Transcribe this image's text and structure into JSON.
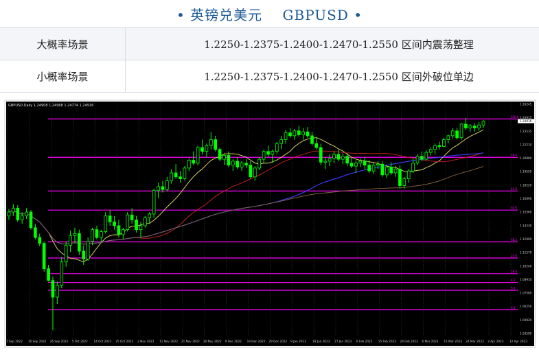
{
  "header": {
    "title": "英镑兑美元",
    "symbol": "GBPUSD",
    "dot": "•"
  },
  "scenarios": [
    {
      "label": "大概率场景",
      "value": "1.2250-1.2375-1.2400-1.2470-1.2550 区间内震荡整理"
    },
    {
      "label": "小概率场景",
      "value": "1.2250-1.2375-1.2400-1.2470-1.2550 区间外破位单边"
    }
  ],
  "chart_data": {
    "type": "candlestick",
    "symbol_label": "GBPUSD,Daily  1.24908 1.24968 1.24774 1.24916",
    "timeframe": "Daily",
    "price_tick_labels": [
      "1.26245",
      "1.24915",
      "1.23535",
      "1.22210",
      "1.20880",
      "1.19550",
      "1.18220",
      "1.16890",
      "1.15560",
      "1.14230",
      "1.12900",
      "1.11570",
      "1.10240",
      "1.08910",
      "1.07580",
      "1.06250",
      "1.04920",
      "1.03590"
    ],
    "current_price": "1.24916",
    "date_labels": [
      "7 Sep 2022",
      "16 Sep 2022",
      "26 Sep 2022",
      "5 Oct 2022",
      "14 Oct 2022",
      "25 Oct 2022",
      "2 Nov 2022",
      "11 Nov 2022",
      "21 Nov 2022",
      "30 Nov 2022",
      "9 Dec 2022",
      "19 Dec 2022",
      "29 Dec 2022",
      "9 Jan 2023",
      "18 Jan 2023",
      "27 Jan 2023",
      "6 Feb 2023",
      "15 Feb 2023",
      "24 Feb 2023",
      "6 Mar 2023",
      "15 Mar 2023",
      "24 Mar 2023",
      "3 Apr 2023",
      "12 Apr 2023"
    ],
    "ylim": [
      1.029,
      1.269
    ],
    "fib_levels": [
      {
        "label": "100.0",
        "price": 1.2512
      },
      {
        "label": "76.4",
        "price": 1.212
      },
      {
        "label": "61.8",
        "price": 1.1775
      },
      {
        "label": "50.0",
        "price": 1.158
      },
      {
        "label": "38.2",
        "price": 1.1255
      },
      {
        "label": "23.6",
        "price": 1.109
      },
      {
        "label": "16.0",
        "price": 1.093
      },
      {
        "label": "9.2",
        "price": 1.084
      },
      {
        "label": "5.0",
        "price": 1.076
      },
      {
        "label": "0.0",
        "price": 1.056
      }
    ],
    "ohlc": [
      [
        1.152,
        1.159,
        1.148,
        1.156
      ],
      [
        1.156,
        1.164,
        1.152,
        1.16
      ],
      [
        1.16,
        1.163,
        1.146,
        1.148
      ],
      [
        1.148,
        1.156,
        1.144,
        1.152
      ],
      [
        1.152,
        1.16,
        1.149,
        1.156
      ],
      [
        1.156,
        1.158,
        1.138,
        1.14
      ],
      [
        1.14,
        1.144,
        1.128,
        1.13
      ],
      [
        1.13,
        1.134,
        1.121,
        1.124
      ],
      [
        1.124,
        1.126,
        1.095,
        1.098
      ],
      [
        1.098,
        1.102,
        1.085,
        1.086
      ],
      [
        1.086,
        1.09,
        1.035,
        1.069
      ],
      [
        1.069,
        1.085,
        1.062,
        1.081
      ],
      [
        1.081,
        1.11,
        1.078,
        1.105
      ],
      [
        1.105,
        1.126,
        1.1,
        1.122
      ],
      [
        1.122,
        1.137,
        1.115,
        1.132
      ],
      [
        1.132,
        1.14,
        1.125,
        1.134
      ],
      [
        1.134,
        1.138,
        1.112,
        1.116
      ],
      [
        1.116,
        1.122,
        1.102,
        1.108
      ],
      [
        1.108,
        1.13,
        1.106,
        1.126
      ],
      [
        1.126,
        1.14,
        1.122,
        1.138
      ],
      [
        1.138,
        1.142,
        1.128,
        1.13
      ],
      [
        1.13,
        1.138,
        1.125,
        1.136
      ],
      [
        1.136,
        1.156,
        1.134,
        1.152
      ],
      [
        1.152,
        1.158,
        1.142,
        1.146
      ],
      [
        1.146,
        1.152,
        1.138,
        1.142
      ],
      [
        1.142,
        1.148,
        1.13,
        1.133
      ],
      [
        1.133,
        1.14,
        1.128,
        1.138
      ],
      [
        1.138,
        1.156,
        1.136,
        1.153
      ],
      [
        1.153,
        1.16,
        1.144,
        1.148
      ],
      [
        1.148,
        1.152,
        1.135,
        1.138
      ],
      [
        1.138,
        1.146,
        1.13,
        1.142
      ],
      [
        1.142,
        1.152,
        1.14,
        1.15
      ],
      [
        1.15,
        1.156,
        1.144,
        1.154
      ],
      [
        1.154,
        1.18,
        1.15,
        1.178
      ],
      [
        1.178,
        1.186,
        1.17,
        1.182
      ],
      [
        1.182,
        1.188,
        1.176,
        1.179
      ],
      [
        1.179,
        1.192,
        1.177,
        1.188
      ],
      [
        1.188,
        1.2,
        1.185,
        1.196
      ],
      [
        1.196,
        1.205,
        1.19,
        1.192
      ],
      [
        1.192,
        1.198,
        1.186,
        1.19
      ],
      [
        1.19,
        1.203,
        1.188,
        1.201
      ],
      [
        1.201,
        1.211,
        1.198,
        1.209
      ],
      [
        1.209,
        1.218,
        1.204,
        1.206
      ],
      [
        1.206,
        1.224,
        1.204,
        1.222
      ],
      [
        1.222,
        1.23,
        1.215,
        1.218
      ],
      [
        1.218,
        1.226,
        1.212,
        1.224
      ],
      [
        1.224,
        1.238,
        1.22,
        1.23
      ],
      [
        1.23,
        1.234,
        1.218,
        1.22
      ],
      [
        1.22,
        1.222,
        1.208,
        1.21
      ],
      [
        1.21,
        1.216,
        1.204,
        1.214
      ],
      [
        1.214,
        1.218,
        1.202,
        1.204
      ],
      [
        1.204,
        1.21,
        1.198,
        1.208
      ],
      [
        1.208,
        1.212,
        1.2,
        1.202
      ],
      [
        1.202,
        1.208,
        1.198,
        1.206
      ],
      [
        1.206,
        1.21,
        1.201,
        1.204
      ],
      [
        1.204,
        1.208,
        1.19,
        1.192
      ],
      [
        1.192,
        1.203,
        1.188,
        1.201
      ],
      [
        1.201,
        1.212,
        1.199,
        1.21
      ],
      [
        1.21,
        1.22,
        1.206,
        1.218
      ],
      [
        1.218,
        1.224,
        1.212,
        1.215
      ],
      [
        1.215,
        1.22,
        1.206,
        1.218
      ],
      [
        1.218,
        1.228,
        1.215,
        1.226
      ],
      [
        1.226,
        1.234,
        1.22,
        1.23
      ],
      [
        1.23,
        1.24,
        1.226,
        1.237
      ],
      [
        1.237,
        1.242,
        1.232,
        1.234
      ],
      [
        1.234,
        1.241,
        1.23,
        1.239
      ],
      [
        1.239,
        1.244,
        1.233,
        1.235
      ],
      [
        1.235,
        1.242,
        1.23,
        1.238
      ],
      [
        1.238,
        1.243,
        1.232,
        1.234
      ],
      [
        1.234,
        1.238,
        1.224,
        1.226
      ],
      [
        1.226,
        1.233,
        1.22,
        1.222
      ],
      [
        1.222,
        1.226,
        1.204,
        1.207
      ],
      [
        1.207,
        1.212,
        1.2,
        1.208
      ],
      [
        1.208,
        1.215,
        1.203,
        1.211
      ],
      [
        1.211,
        1.218,
        1.206,
        1.215
      ],
      [
        1.215,
        1.22,
        1.208,
        1.21
      ],
      [
        1.21,
        1.216,
        1.205,
        1.213
      ],
      [
        1.213,
        1.216,
        1.203,
        1.206
      ],
      [
        1.206,
        1.212,
        1.201,
        1.203
      ],
      [
        1.203,
        1.209,
        1.196,
        1.206
      ],
      [
        1.206,
        1.211,
        1.202,
        1.208
      ],
      [
        1.208,
        1.212,
        1.2,
        1.204
      ],
      [
        1.204,
        1.209,
        1.196,
        1.198
      ],
      [
        1.198,
        1.206,
        1.195,
        1.204
      ],
      [
        1.204,
        1.208,
        1.2,
        1.205
      ],
      [
        1.205,
        1.208,
        1.192,
        1.194
      ],
      [
        1.194,
        1.204,
        1.191,
        1.202
      ],
      [
        1.202,
        1.207,
        1.194,
        1.196
      ],
      [
        1.196,
        1.203,
        1.192,
        1.2
      ],
      [
        1.2,
        1.204,
        1.18,
        1.183
      ],
      [
        1.183,
        1.192,
        1.18,
        1.19
      ],
      [
        1.19,
        1.2,
        1.186,
        1.198
      ],
      [
        1.198,
        1.21,
        1.196,
        1.206
      ],
      [
        1.206,
        1.215,
        1.204,
        1.213
      ],
      [
        1.213,
        1.218,
        1.208,
        1.21
      ],
      [
        1.21,
        1.219,
        1.209,
        1.217
      ],
      [
        1.217,
        1.222,
        1.214,
        1.22
      ],
      [
        1.22,
        1.226,
        1.215,
        1.224
      ],
      [
        1.224,
        1.228,
        1.22,
        1.223
      ],
      [
        1.223,
        1.232,
        1.222,
        1.23
      ],
      [
        1.23,
        1.235,
        1.226,
        1.234
      ],
      [
        1.234,
        1.242,
        1.231,
        1.239
      ],
      [
        1.239,
        1.242,
        1.23,
        1.232
      ],
      [
        1.232,
        1.247,
        1.23,
        1.246
      ],
      [
        1.246,
        1.252,
        1.24,
        1.242
      ],
      [
        1.242,
        1.246,
        1.238,
        1.244
      ],
      [
        1.244,
        1.247,
        1.238,
        1.242
      ],
      [
        1.242,
        1.248,
        1.239,
        1.245
      ],
      [
        1.245,
        1.25,
        1.242,
        1.249
      ]
    ]
  },
  "colors": {
    "bg": "#000000",
    "up": "#00ff00",
    "down": "#000000",
    "grid": "#2a2a2a",
    "fib": "#ff00ff",
    "ma_fast": "#d8d060",
    "ma_mid": "#c02020",
    "ma_slow": "#3a3aff",
    "ma_long": "#806040"
  }
}
